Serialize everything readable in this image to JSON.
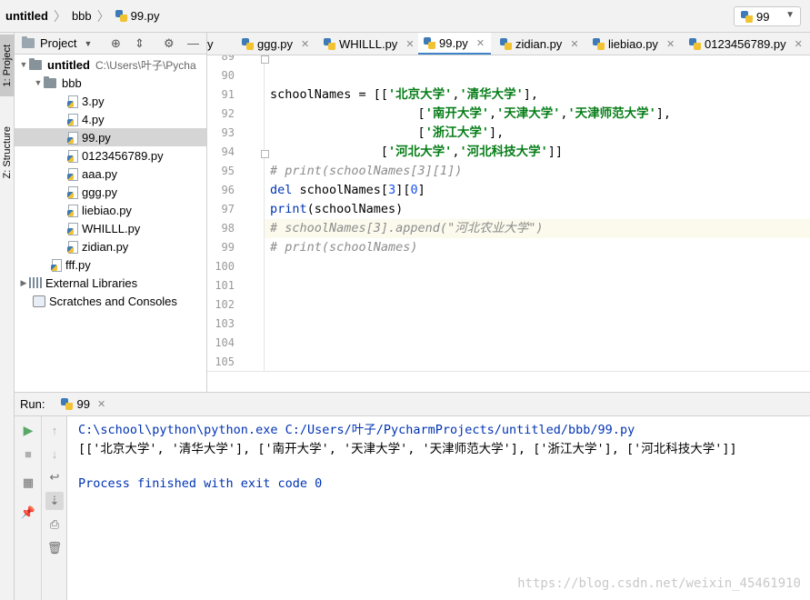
{
  "breadcrumb": {
    "project": "untitled",
    "folder": "bbb",
    "file": "99.py"
  },
  "run_config": {
    "label": "99"
  },
  "left_strip": {
    "project_tab": "1: Project",
    "structure_tab": "Z: Structure"
  },
  "project_panel": {
    "title": "Project",
    "root": {
      "name": "untitled",
      "path": "C:\\Users\\叶子\\Pycha"
    },
    "folder": "bbb",
    "files": [
      "3.py",
      "4.py",
      "99.py",
      "0123456789.py",
      "aaa.py",
      "ggg.py",
      "liebiao.py",
      "WHILLL.py",
      "zidian.py"
    ],
    "selected_file": "99.py",
    "root_file": "fff.py",
    "external_libraries": "External Libraries",
    "scratches": "Scratches and Consoles"
  },
  "tabs": [
    {
      "label": "y",
      "active": false
    },
    {
      "label": "ggg.py",
      "active": false
    },
    {
      "label": "WHILLL.py",
      "active": false
    },
    {
      "label": "99.py",
      "active": true
    },
    {
      "label": "zidian.py",
      "active": false
    },
    {
      "label": "liebiao.py",
      "active": false
    },
    {
      "label": "0123456789.py",
      "active": false
    }
  ],
  "editor": {
    "line_numbers": [
      "89",
      "90",
      "91",
      "92",
      "93",
      "94",
      "95",
      "96",
      "97",
      "98",
      "99",
      "100",
      "101",
      "102",
      "103",
      "104",
      "105"
    ],
    "highlighted_line": "98",
    "code": {
      "l91_a": "schoolNames = [[",
      "l91_s1": "'北京大学'",
      "l91_c": ",",
      "l91_s2": "'清华大学'",
      "l91_e": "],",
      "l92_pad": "                    [",
      "l92_s1": "'南开大学'",
      "l92_c1": ",",
      "l92_s2": "'天津大学'",
      "l92_c2": ",",
      "l92_s3": "'天津师范大学'",
      "l92_e": "],",
      "l93_pad": "                    [",
      "l93_s1": "'浙江大学'",
      "l93_e": "],",
      "l94_pad": "               [",
      "l94_s1": "'河北大学'",
      "l94_c": ",",
      "l94_s2": "'河北科技大学'",
      "l94_e": "]]",
      "l95": "# print(schoolNames[3][1])",
      "l96_kw": "del",
      "l96_a": " schoolNames[",
      "l96_n1": "3",
      "l96_b": "][",
      "l96_n2": "0",
      "l96_c": "]",
      "l97_kw": "print",
      "l97_a": "(schoolNames)",
      "l98": "# schoolNames[3].append(\"河北农业大学\")",
      "l99": "# print(schoolNames)"
    }
  },
  "run_panel": {
    "label": "Run:",
    "tab": "99",
    "console": [
      "C:\\school\\python\\python.exe C:/Users/叶子/PycharmProjects/untitled/bbb/99.py",
      "[['北京大学', '清华大学'], ['南开大学', '天津大学', '天津师范大学'], ['浙江大学'], ['河北科技大学']]",
      "",
      "Process finished with exit code 0"
    ]
  },
  "watermark": "https://blog.csdn.net/weixin_45461910",
  "colors": {
    "accent": "#4083c9",
    "string": "#067d17",
    "keyword": "#0033b3",
    "comment": "#8c8c8c",
    "selection": "#d5d5d5"
  }
}
